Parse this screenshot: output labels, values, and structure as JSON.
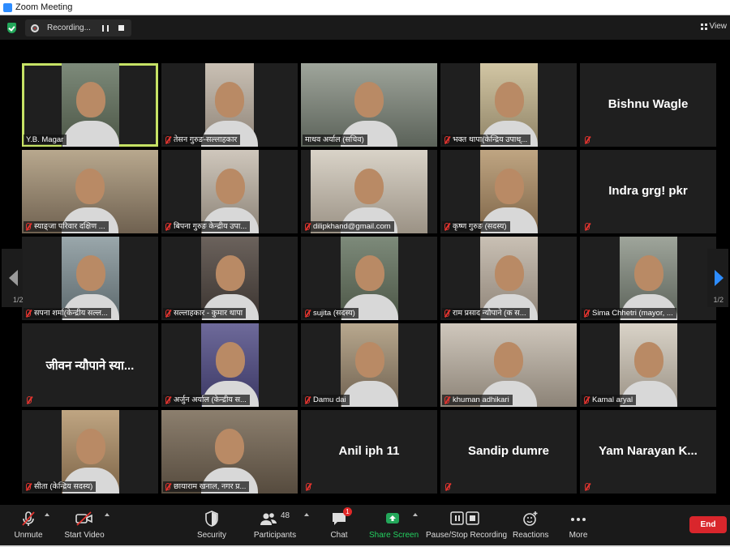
{
  "window": {
    "title": "Zoom Meeting"
  },
  "recording": {
    "label": "Recording..."
  },
  "view": {
    "label": "View"
  },
  "pagination": {
    "left": "1/2",
    "right": "1/2"
  },
  "colors": {
    "active_speaker": "#c6e265",
    "muted": "#e3342f",
    "end": "#d9262c",
    "share": "#23a75a",
    "next_arrow": "#2d8cff"
  },
  "participants": [
    {
      "name": "Y.B. Magar",
      "video": true,
      "muted": false,
      "active": true
    },
    {
      "name": "तेसन गुरुङ-सल्लाहकार",
      "video": true,
      "muted": true
    },
    {
      "name": "माधव अर्याल (सचिव)",
      "video": true,
      "muted": false
    },
    {
      "name": "भक्त थापा(केन्द्रिय उपाध्...",
      "video": true,
      "muted": true
    },
    {
      "name": "Bishnu Wagle",
      "video": false,
      "muted": true
    },
    {
      "name": "स्याङ्जा परिवार दक्षिण ...",
      "video": true,
      "muted": true
    },
    {
      "name": "बिपना गुरुङ केन्द्रीय उपा...",
      "video": true,
      "muted": true
    },
    {
      "name": "dilipkhand@gmail.com",
      "video": true,
      "muted": true
    },
    {
      "name": "कृष्ण गुरुङ (सदस्य)",
      "video": true,
      "muted": true
    },
    {
      "name": "Indra grg! pkr",
      "video": false,
      "muted": true
    },
    {
      "name": "सपना शर्मा(केन्द्रीय सल्ल...",
      "video": true,
      "muted": true
    },
    {
      "name": "सल्लाहकार - कुमार थापा",
      "video": true,
      "muted": true
    },
    {
      "name": "sujita (सदस्य)",
      "video": true,
      "muted": true
    },
    {
      "name": "राम प्रसाद न्यौपाने (क स...",
      "video": true,
      "muted": true
    },
    {
      "name": "Sima Chhetri (mayor, ...",
      "video": true,
      "muted": true
    },
    {
      "name": "जीवन न्यौपाने स्या...",
      "video": false,
      "muted": true
    },
    {
      "name": "अर्जुन अर्याल (केन्द्रीय स...",
      "video": true,
      "muted": true
    },
    {
      "name": "Damu dai",
      "video": true,
      "muted": true
    },
    {
      "name": "khuman adhikari",
      "video": true,
      "muted": true
    },
    {
      "name": "Kamal aryal",
      "video": true,
      "muted": true
    },
    {
      "name": "सीता (केन्द्रिय सदस्य)",
      "video": true,
      "muted": true
    },
    {
      "name": "छायाराम खनाल, नगर प्र...",
      "video": true,
      "muted": true
    },
    {
      "name": "Anil iph 11",
      "video": false,
      "muted": true
    },
    {
      "name": "Sandip dumre",
      "video": false,
      "muted": true
    },
    {
      "name": "Yam Narayan K...",
      "video": false,
      "muted": true
    }
  ],
  "toolbar": {
    "unmute": "Unmute",
    "start_video": "Start Video",
    "security": "Security",
    "participants": "Participants",
    "participants_count": "48",
    "chat": "Chat",
    "chat_badge": "1",
    "share_screen": "Share Screen",
    "recording": "Pause/Stop Recording",
    "reactions": "Reactions",
    "more": "More",
    "end": "End"
  }
}
